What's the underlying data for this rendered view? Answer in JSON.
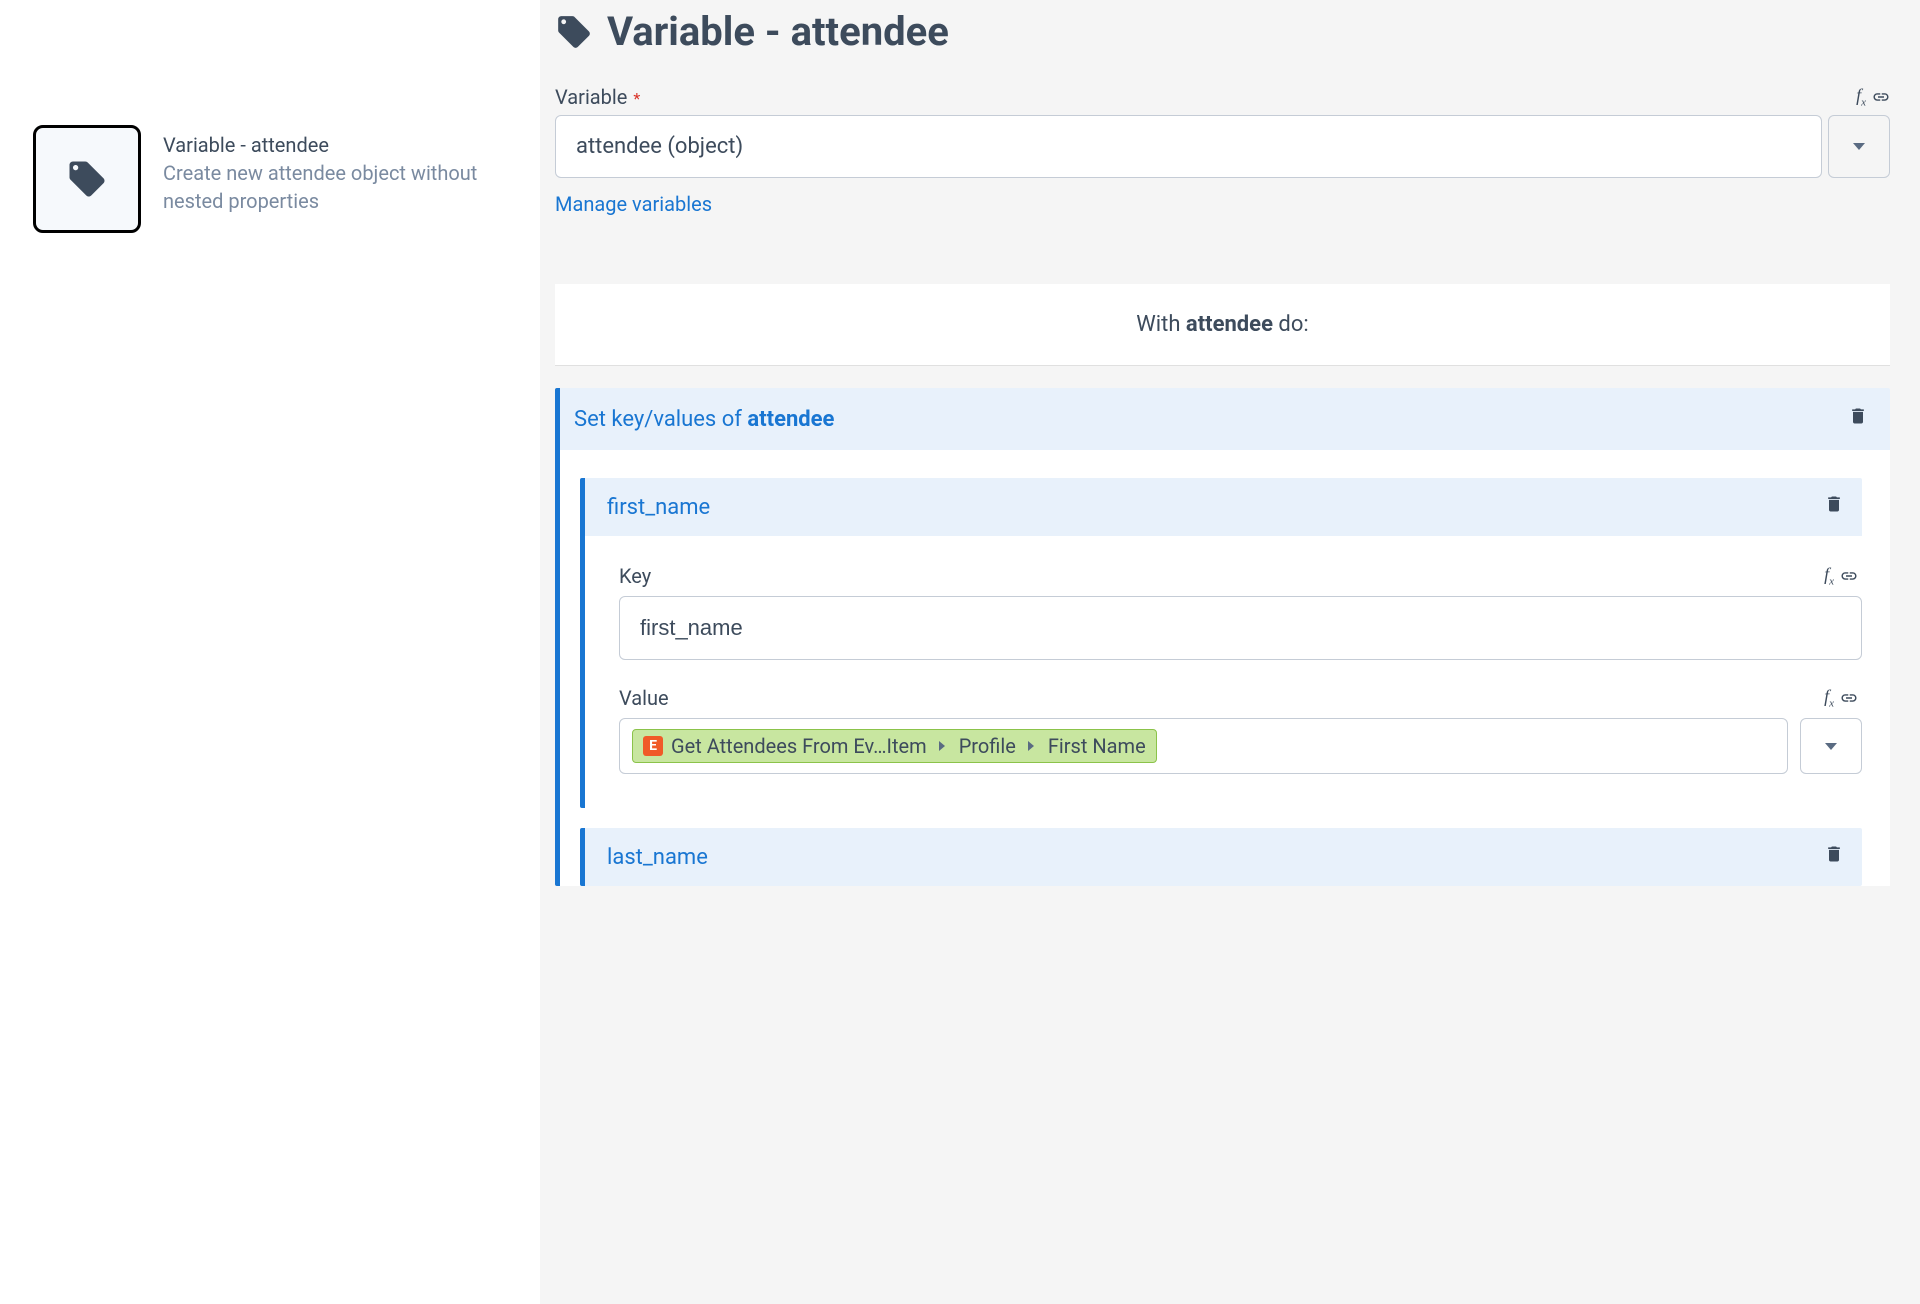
{
  "left": {
    "title": "Variable - attendee",
    "description": "Create new attendee object without nested properties"
  },
  "header": {
    "title": "Variable - attendee"
  },
  "variable": {
    "label": "Variable",
    "value": "attendee (object)",
    "manage_link": "Manage variables"
  },
  "with_do": {
    "prefix": "With ",
    "var": "attendee",
    "suffix": " do:"
  },
  "set_kv": {
    "prefix": "Set key/values of ",
    "var": "attendee"
  },
  "keys": [
    {
      "name": "first_name",
      "key_label": "Key",
      "key_value": "first_name",
      "value_label": "Value",
      "pill": {
        "segments": [
          "Get Attendees From Ev…Item",
          "Profile",
          "First Name"
        ]
      }
    },
    {
      "name": "last_name"
    }
  ]
}
